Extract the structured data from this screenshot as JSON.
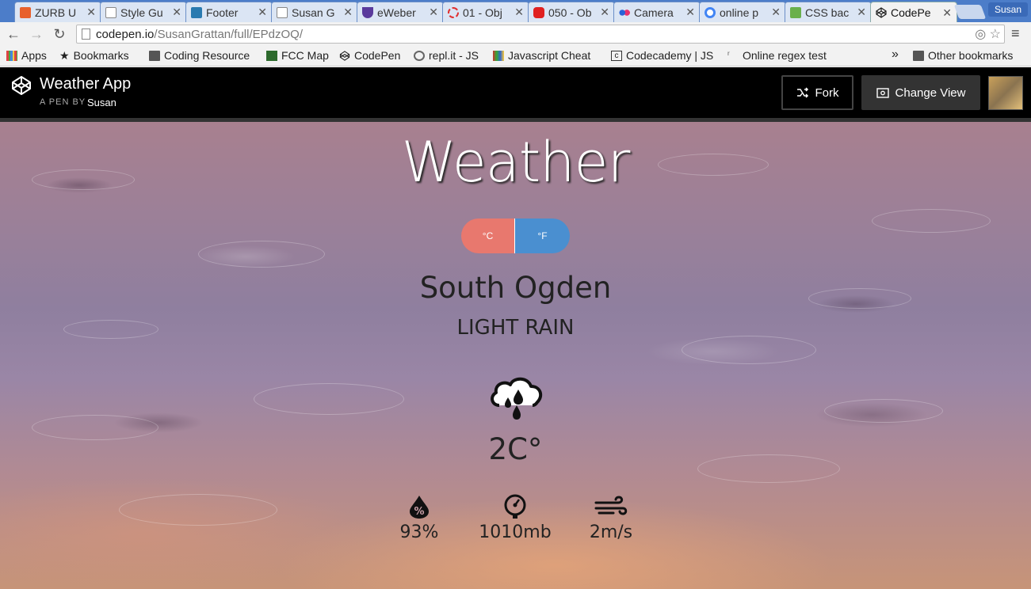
{
  "browser": {
    "tabs": [
      {
        "title": "ZURB U",
        "favicon_color": "#e8602c"
      },
      {
        "title": "Style Gu",
        "favicon_color": "#ffffff"
      },
      {
        "title": "Footer",
        "favicon_color": "#2a7ab0"
      },
      {
        "title": "Susan G",
        "favicon_color": "#ffffff"
      },
      {
        "title": "eWeber",
        "favicon_color": "#5a3a9c"
      },
      {
        "title": "01 - Obj",
        "favicon_color": "#e03030"
      },
      {
        "title": "050 - Ob",
        "favicon_color": "#e02020"
      },
      {
        "title": "Camera",
        "favicon_color": "#2a62d8"
      },
      {
        "title": "online p",
        "favicon_color": "#4285f4"
      },
      {
        "title": "CSS bac",
        "favicon_color": "#6ab04c"
      },
      {
        "title": "CodePe",
        "favicon_color": "#222222"
      }
    ],
    "profile_name": "Susan",
    "url_host": "codepen.io",
    "url_path": "/SusanGrattan/full/EPdzOQ/",
    "bookmarks": [
      {
        "label": "Apps"
      },
      {
        "label": "Bookmarks"
      },
      {
        "label": "Coding Resource"
      },
      {
        "label": "FCC Map"
      },
      {
        "label": "CodePen"
      },
      {
        "label": "repl.it - JS"
      },
      {
        "label": "Javascript Cheat"
      },
      {
        "label": "Codecademy | JS"
      },
      {
        "label": "Online regex test"
      }
    ],
    "overflow_chevron": "»",
    "other_bookmarks": "Other bookmarks"
  },
  "codepen": {
    "pen_title": "Weather App",
    "pen_by": "A PEN BY",
    "author": "Susan",
    "fork_label": "Fork",
    "change_view_label": "Change View"
  },
  "weather": {
    "title": "Weather",
    "celsius_label": "°C",
    "fahrenheit_label": "°F",
    "celsius_color": "#e8786e",
    "fahrenheit_color": "#4a8fd0",
    "city": "South Ogden",
    "condition": "LIGHT RAIN",
    "condition_icon": "cloud-rain-icon",
    "temperature": "2C°",
    "humidity": "93%",
    "pressure": "1010mb",
    "wind": "2m/s"
  }
}
